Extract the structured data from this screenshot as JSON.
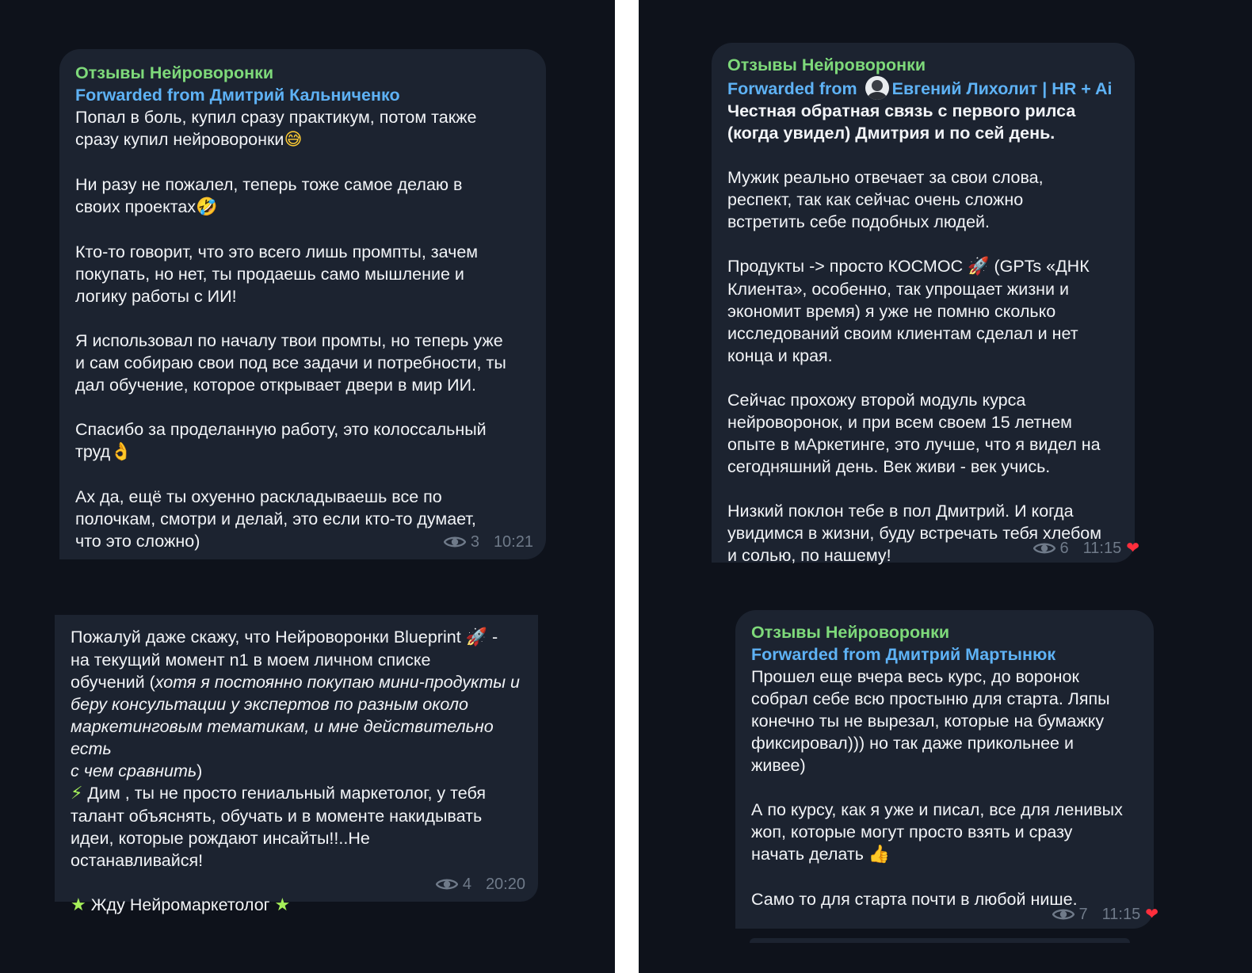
{
  "bubble1": {
    "channel": "Отзывы Нейроворонки",
    "forwarded": "Forwarded from Дмитрий Кальниченко",
    "line1": "Попал в боль, купил сразу практикум, потом также",
    "line2": "сразу купил нейроворонки",
    "emoji1": "😅",
    "para2a": "Ни разу не пожалел, теперь тоже самое делаю в",
    "para2b": "своих проектах",
    "emoji2": "🤣",
    "para3": "Кто-то говорит, что это всего лишь промпты, зачем\nпокупать, но нет, ты продаешь само мышление и\nлогику работы с ИИ!",
    "para4": "Я использовал по началу твои промты, но теперь уже\nи сам собираю свои под все задачи и потребности, ты\nдал обучение, которое открывает двери в мир ИИ.",
    "para5a": "Спасибо за проделанную работу, это колоссальный",
    "para5b": "труд",
    "emoji3": "👌",
    "para6": "Ах да, ещё ты охуенно раскладываешь все по\nполочкам, смотри и делай, это если кто-то думает,\nчто это сложно)",
    "views": "3",
    "time": "10:21"
  },
  "bubble2": {
    "p1a": "Пожалуй даже скажу, что Нейроворонки Blueprint",
    "emoji_rocket": "🚀",
    "p1b": " -\nна текущий момент n1 в моем личном списке\nобучений (",
    "p1italic": "хотя я постоянно покупаю мини-продукты и\nберу консультации у экспертов по разным около\nмаркетинговым тематикам, и мне действительно есть\nс чем сравнить",
    "p1c": ")",
    "emoji_bolt": "⚡",
    "p2": " Дим , ты не просто гениальный маркетолог, у тебя\nталант объяснять, обучать и в моменте накидывать\nидеи, которые рождают инсайты!!..Не\nостанавливайся!",
    "star": "★",
    "p3": " Жду Нейромаркетолог ",
    "views": "4",
    "time": "20:20"
  },
  "bubble3": {
    "channel": "Отзывы Нейроворонки",
    "forwarded_prefix": "Forwarded from ",
    "forwarded_name": "Евгений Лихолит | HR + Ai",
    "bold_text": "Честная обратная связь с первого рилса\n(когда увидел) Дмитрия и по сей день.",
    "para2": "Мужик реально отвечает за свои слова,\nреспект, так как сейчас очень сложно\nвстретить себе подобных людей.",
    "para3a": "Продукты -> просто КОСМОС ",
    "emoji_rocket": "🚀",
    "para3b": " (GPTs «ДНК\nКлиента», особенно, так упрощает жизни и\nэкономит время) я уже не помню сколько\nисследований своим клиентам сделал и нет\nконца и края.",
    "para4": "Сейчас прохожу второй модуль курса\nнейроворонок, и при всем своем 15 летнем\nопыте в мАркетинге, это лучше, что я видел на\nсегодняшний день. Век живи - век учись.",
    "para5": "Низкий поклон тебе в пол Дмитрий. И когда\nувидимся в жизни, буду встречать тебя хлебом\nи солью, по нашему!",
    "views": "6",
    "time": "11:15",
    "reaction": "❤"
  },
  "bubble4": {
    "channel": "Отзывы Нейроворонки",
    "forwarded": "Forwarded from Дмитрий Мартынюк",
    "para1": "Прошел еще вчера весь курс, до воронок\nсобрал себе всю простыню для старта. Ляпы\nконечно ты не вырезал, которые на бумажку\nфиксировал))) но так даже прикольнее и\nживее)",
    "para2": "А по курсу, как я уже и писал, все для ленивых\nжоп, которые могут просто взять и сразу\nначать делать ",
    "emoji_thumb": "👍",
    "para3": "Само то для старта почти в любой нише.",
    "views": "7",
    "time": "11:15",
    "reaction": "❤"
  }
}
